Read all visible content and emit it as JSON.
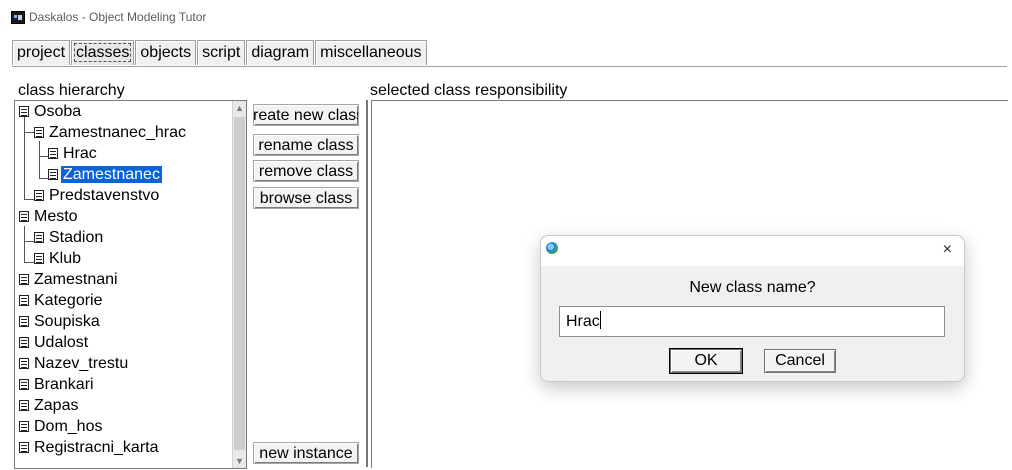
{
  "window": {
    "title": "Daskalos - Object Modeling Tutor",
    "icon": "app-icon"
  },
  "tabs": [
    {
      "label": "project",
      "active": false
    },
    {
      "label": "classes",
      "active": true
    },
    {
      "label": "objects",
      "active": false
    },
    {
      "label": "script",
      "active": false
    },
    {
      "label": "diagram",
      "active": false
    },
    {
      "label": "miscellaneous",
      "active": false
    }
  ],
  "labels": {
    "class_hierarchy": "class hierarchy",
    "selected_class_responsibility": "selected class responsibility"
  },
  "tree": {
    "selected": "Zamestnanec",
    "nodes": [
      {
        "label": "Osoba",
        "depth": 0
      },
      {
        "label": "Zamestnanec_hrac",
        "depth": 1
      },
      {
        "label": "Hrac",
        "depth": 2
      },
      {
        "label": "Zamestnanec",
        "depth": 2
      },
      {
        "label": "Predstavenstvo",
        "depth": 1
      },
      {
        "label": "Mesto",
        "depth": 0
      },
      {
        "label": "Stadion",
        "depth": 1
      },
      {
        "label": "Klub",
        "depth": 1
      },
      {
        "label": "Zamestnani",
        "depth": 0
      },
      {
        "label": "Kategorie",
        "depth": 0
      },
      {
        "label": "Soupiska",
        "depth": 0
      },
      {
        "label": "Udalost",
        "depth": 0
      },
      {
        "label": "Nazev_trestu",
        "depth": 0
      },
      {
        "label": "Brankari",
        "depth": 0
      },
      {
        "label": "Zapas",
        "depth": 0
      },
      {
        "label": "Dom_hos",
        "depth": 0
      },
      {
        "label": "Registracni_karta",
        "depth": 0
      }
    ]
  },
  "buttons": {
    "create_class": "create new class",
    "rename_class": "rename class",
    "remove_class": "remove class",
    "browse_class": "browse class",
    "new_instance": "new instance"
  },
  "dialog": {
    "prompt": "New class name?",
    "input_value": "Hrac",
    "ok": "OK",
    "cancel": "Cancel",
    "close_glyph": "×"
  }
}
